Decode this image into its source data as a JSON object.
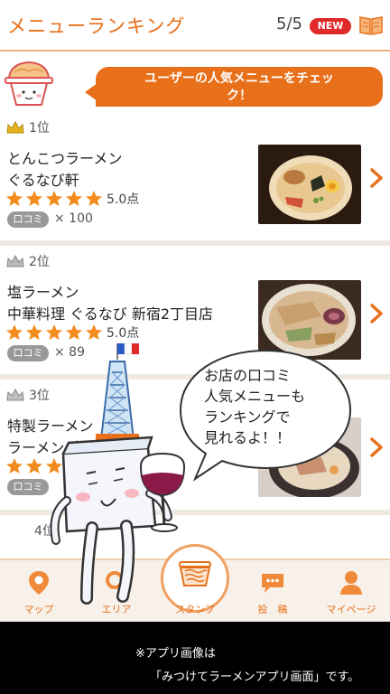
{
  "header": {
    "title": "メニューランキング",
    "page_count": "5/5",
    "new_badge": "NEW"
  },
  "banner": {
    "line1": "ユーザーの人気メニューをチェッ",
    "line2": "ク！"
  },
  "ranks": [
    {
      "rank": "1位",
      "name": "とんこつラーメン",
      "shop": "ぐるなび軒",
      "score": "5.0点",
      "badge": "口コミ",
      "count": "× 100",
      "stars": 5
    },
    {
      "rank": "2位",
      "name": "塩ラーメン",
      "shop": "中華料理 ぐるなび 新宿2丁目店",
      "score": "5.0点",
      "badge": "口コミ",
      "count": "× 89",
      "stars": 5
    },
    {
      "rank": "3位",
      "name": "特製ラーメン",
      "shop": "ラーメング",
      "score": "",
      "badge": "口コミ",
      "count": "",
      "stars": 5
    },
    {
      "rank": "4位"
    }
  ],
  "speech": {
    "line1": "お店の口コミ",
    "line2": "人気メニューも",
    "line3": "ランキングで",
    "line4": "見れるよ！！"
  },
  "tabs": [
    {
      "label": "マップ",
      "icon": "map-pin-icon"
    },
    {
      "label": "エリア",
      "icon": "search-icon"
    },
    {
      "label": "スタンプ",
      "icon": "ramen-bowl-icon"
    },
    {
      "label": "投　稿",
      "icon": "chat-bubble-icon"
    },
    {
      "label": "マイページ",
      "icon": "person-icon"
    }
  ],
  "footer": {
    "line1": "※アプリ画像は",
    "line2": "「みつけてラーメンアプリ画面」です。"
  },
  "colors": {
    "accent": "#e8701a",
    "star": "#f28c1e",
    "badge_red": "#e02a2a"
  }
}
